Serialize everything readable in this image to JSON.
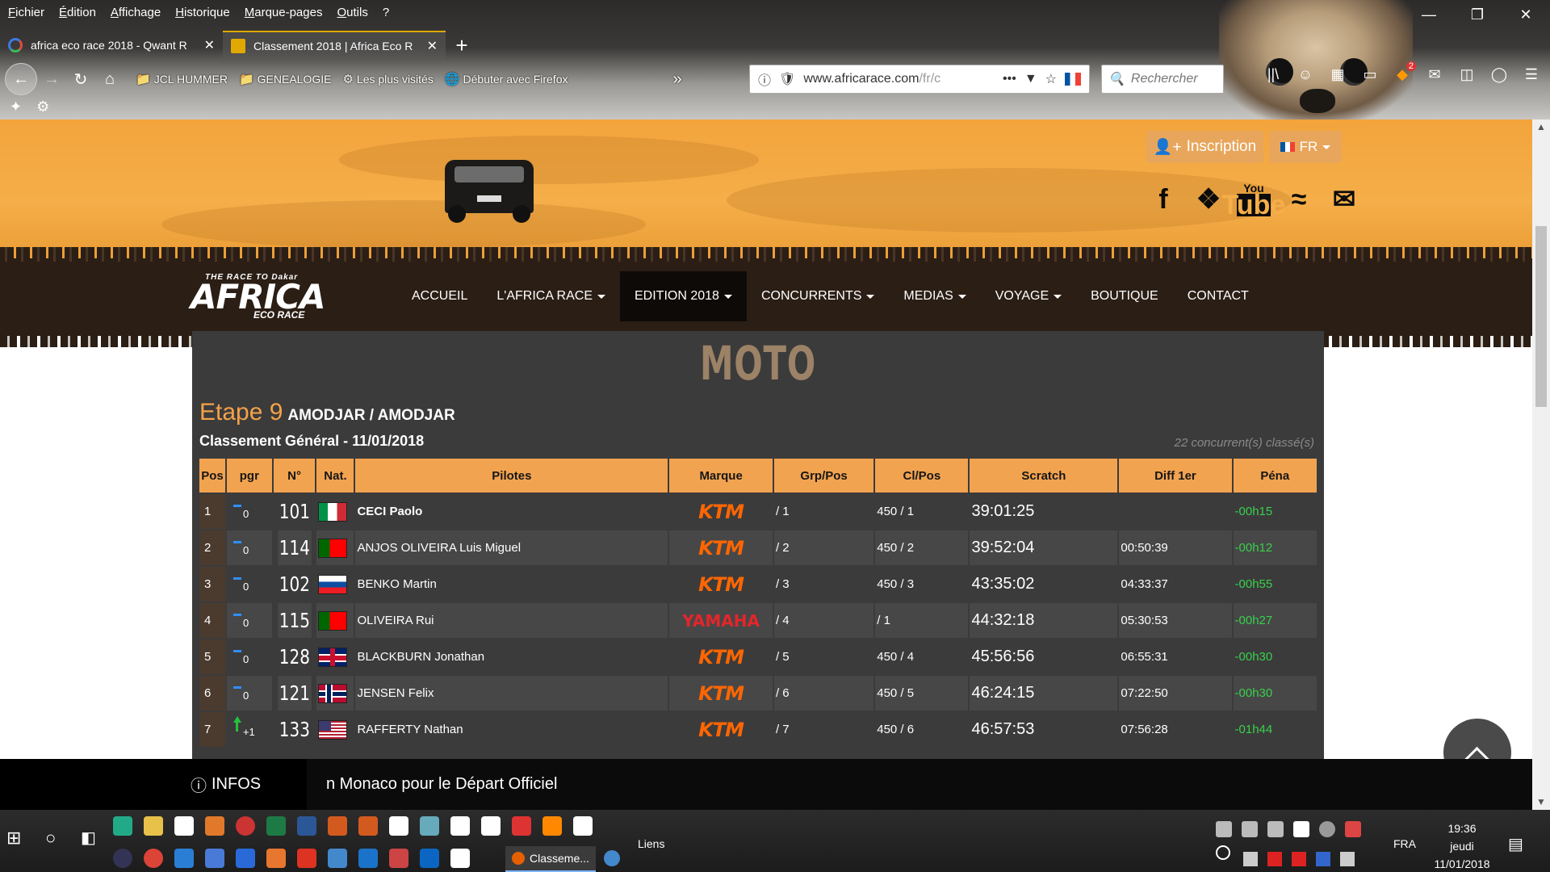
{
  "menubar": [
    "Fichier",
    "Édition",
    "Affichage",
    "Historique",
    "Marque-pages",
    "Outils",
    "?"
  ],
  "tabs": [
    {
      "title": "africa eco race 2018 - Qwant R",
      "favicon_color": "#3d7be2"
    },
    {
      "title": "Classement 2018 | Africa Eco R",
      "favicon_color": "#e0a800"
    }
  ],
  "bookmarks": [
    "JCL HUMMER",
    "GENEALOGIE",
    "Les plus visités",
    "Débuter avec Firefox"
  ],
  "url": {
    "host": "www.africarace.com",
    "path": "/fr/c"
  },
  "search_placeholder": "Rechercher",
  "toolbar_badge": "2",
  "hero": {
    "inscription_label": "Inscription",
    "lang_label": "FR"
  },
  "nav": [
    {
      "label": "ACCUEIL",
      "dropdown": false,
      "active": false
    },
    {
      "label": "L'AFRICA RACE",
      "dropdown": true,
      "active": false
    },
    {
      "label": "EDITION 2018",
      "dropdown": true,
      "active": true
    },
    {
      "label": "CONCURRENTS",
      "dropdown": true,
      "active": false
    },
    {
      "label": "MEDIAS",
      "dropdown": true,
      "active": false
    },
    {
      "label": "VOYAGE",
      "dropdown": true,
      "active": false
    },
    {
      "label": "BOUTIQUE",
      "dropdown": false,
      "active": false
    },
    {
      "label": "CONTACT",
      "dropdown": false,
      "active": false
    }
  ],
  "logo": {
    "top": "THE RACE TO Dakar",
    "main": "AFRICA",
    "sub": "ECO RACE"
  },
  "results": {
    "category": "MOTO",
    "stage_label": "Etape 9",
    "stage_location": "AMODJAR / AMODJAR",
    "classement": "Classement Général - 11/01/2018",
    "classified": "22 concurrent(s) classé(s)",
    "headers": [
      "Pos",
      "pgr",
      "N°",
      "Nat.",
      "Pilotes",
      "Marque",
      "Grp/Pos",
      "Cl/Pos",
      "Scratch",
      "Diff 1er",
      "Péna"
    ],
    "rows": [
      {
        "pos": "1",
        "pgr": "0",
        "pgr_dir": "same",
        "num": "101",
        "flag": "it",
        "pilote": "CECI Paolo",
        "marque": "KTM",
        "grp": "/ 1",
        "cl": "450 / 1",
        "scratch": "39:01:25",
        "diff": "",
        "pena": "-00h15"
      },
      {
        "pos": "2",
        "pgr": "0",
        "pgr_dir": "same",
        "num": "114",
        "flag": "pt",
        "pilote": "ANJOS OLIVEIRA Luis Miguel",
        "marque": "KTM",
        "grp": "/ 2",
        "cl": "450 / 2",
        "scratch": "39:52:04",
        "diff": "00:50:39",
        "pena": "-00h12"
      },
      {
        "pos": "3",
        "pgr": "0",
        "pgr_dir": "same",
        "num": "102",
        "flag": "sk",
        "pilote": "BENKO Martin",
        "marque": "KTM",
        "grp": "/ 3",
        "cl": "450 / 3",
        "scratch": "43:35:02",
        "diff": "04:33:37",
        "pena": "-00h55"
      },
      {
        "pos": "4",
        "pgr": "0",
        "pgr_dir": "same",
        "num": "115",
        "flag": "pt",
        "pilote": "OLIVEIRA Rui",
        "marque": "YAMAHA",
        "grp": "/ 4",
        "cl": "/ 1",
        "scratch": "44:32:18",
        "diff": "05:30:53",
        "pena": "-00h27"
      },
      {
        "pos": "5",
        "pgr": "0",
        "pgr_dir": "same",
        "num": "128",
        "flag": "gb",
        "pilote": "BLACKBURN Jonathan",
        "marque": "KTM",
        "grp": "/ 5",
        "cl": "450 / 4",
        "scratch": "45:56:56",
        "diff": "06:55:31",
        "pena": "-00h30"
      },
      {
        "pos": "6",
        "pgr": "0",
        "pgr_dir": "same",
        "num": "121",
        "flag": "no",
        "pilote": "JENSEN Felix",
        "marque": "KTM",
        "grp": "/ 6",
        "cl": "450 / 5",
        "scratch": "46:24:15",
        "diff": "07:22:50",
        "pena": "-00h30"
      },
      {
        "pos": "7",
        "pgr": "+1",
        "pgr_dir": "up",
        "num": "133",
        "flag": "us",
        "pilote": "RAFFERTY Nathan",
        "marque": "KTM",
        "grp": "/ 7",
        "cl": "450 / 6",
        "scratch": "46:57:53",
        "diff": "07:56:28",
        "pena": "-01h44"
      }
    ]
  },
  "infos": {
    "label": "INFOS",
    "text": "n Monaco pour le Départ Officiel"
  },
  "taskbar": {
    "active_app": "Classeme...",
    "liens": "Liens",
    "lang": "FRA",
    "time": "19:36",
    "day": "jeudi",
    "date": "11/01/2018"
  },
  "colors": {
    "accent": "#f2a350",
    "panel": "#3b3b3c",
    "nav": "#2b1e15",
    "penalty": "#39d04a",
    "ktm": "#ff6600"
  }
}
